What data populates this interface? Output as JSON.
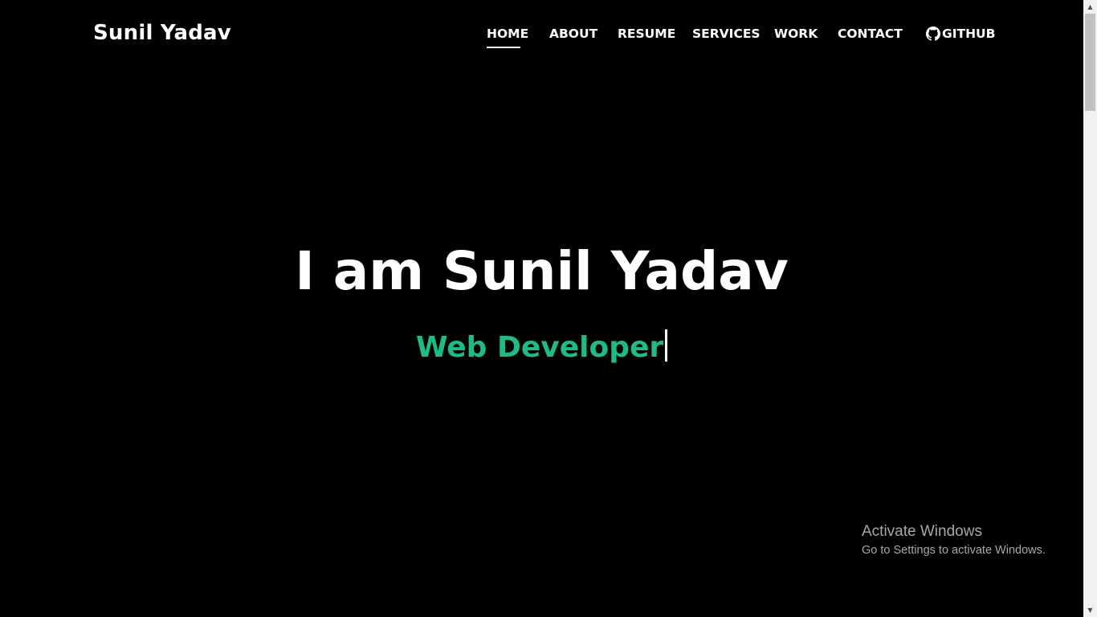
{
  "header": {
    "brand": "Sunil Yadav",
    "nav": [
      {
        "label": "HOME",
        "active": true
      },
      {
        "label": "ABOUT",
        "active": false
      },
      {
        "label": "RESUME",
        "active": false
      },
      {
        "label": "SERVICES",
        "active": false
      },
      {
        "label": "WORK",
        "active": false
      },
      {
        "label": "CONTACT",
        "active": false
      }
    ],
    "github": {
      "label": "GITHUB",
      "icon": "github-icon"
    }
  },
  "hero": {
    "title": "I am Sunil Yadav",
    "subtitle": "Web Developer"
  },
  "watermark": {
    "title": "Activate Windows",
    "subtitle": "Go to Settings to activate Windows."
  },
  "colors": {
    "background": "#000000",
    "text": "#ffffff",
    "accent": "#20b98a"
  }
}
